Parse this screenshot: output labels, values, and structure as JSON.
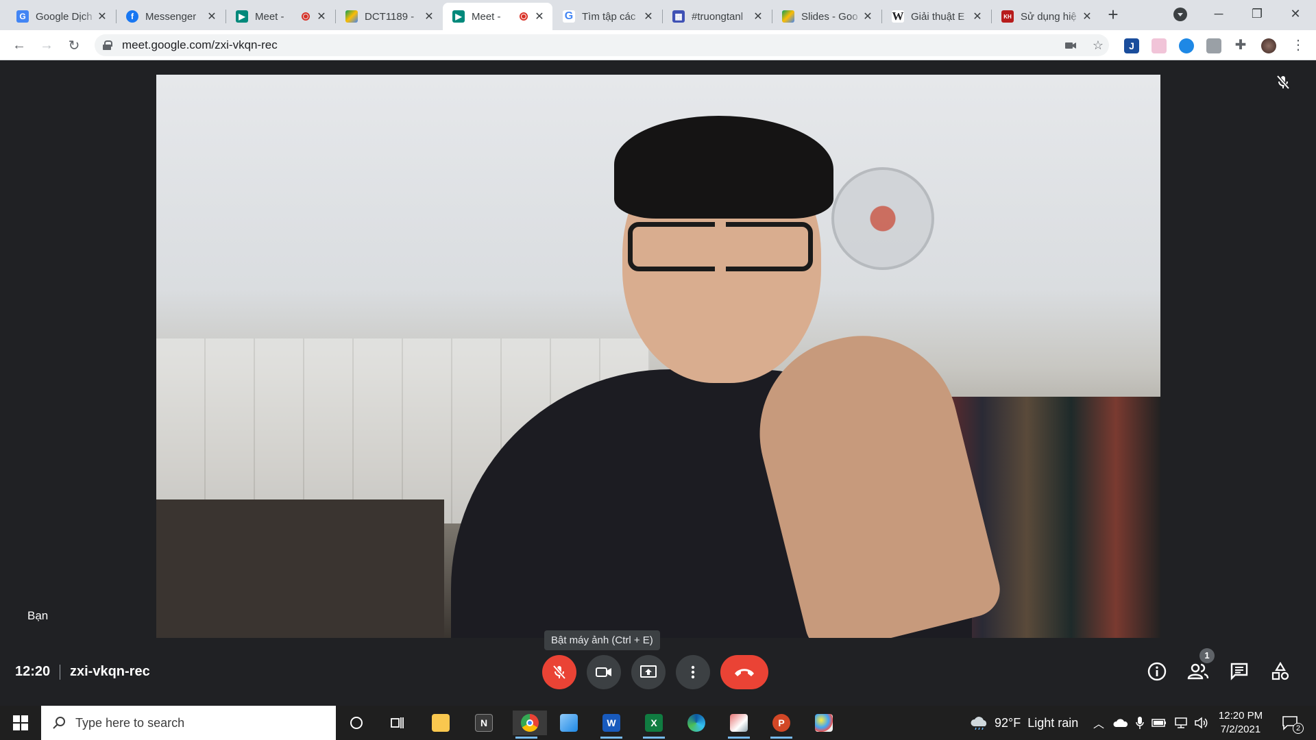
{
  "browser": {
    "tabs": [
      {
        "title": "Google Dịch",
        "favicon": "google-translate-icon",
        "color": "#4285f4"
      },
      {
        "title": "Messenger",
        "favicon": "facebook-icon",
        "color": "#1877f2"
      },
      {
        "title": "Meet -",
        "favicon": "google-meet-icon",
        "color": "#00897b",
        "recording": true
      },
      {
        "title": "DCT1189 -",
        "favicon": "google-drive-icon",
        "color": "#fbbc04"
      },
      {
        "title": "Meet -",
        "favicon": "google-meet-icon",
        "color": "#00897b",
        "recording": true,
        "active": true
      },
      {
        "title": "Tìm tập các",
        "favicon": "google-icon",
        "color": "#ea4335"
      },
      {
        "title": "#truongtanl",
        "favicon": "calendar-table-icon",
        "color": "#3f51b5"
      },
      {
        "title": "Slides - Goo",
        "favicon": "google-drive-icon",
        "color": "#fbbc04"
      },
      {
        "title": "Giải thuật E",
        "favicon": "wikipedia-icon",
        "color": "#ffffff"
      },
      {
        "title": "Sử dụng hiệ",
        "favicon": "khpt-icon",
        "color": "#b71c1c"
      }
    ],
    "url": "meet.google.com/zxi-vkqn-rec"
  },
  "meet": {
    "participant_name": "Bạn",
    "tooltip": "Bật máy ảnh (Ctrl + E)",
    "time": "12:20",
    "meeting_code": "zxi-vkqn-rec",
    "people_count": "1",
    "controls": {
      "mic": "mic-off-icon",
      "camera": "camera-icon",
      "present": "present-screen-icon",
      "more": "more-options-icon",
      "hangup": "end-call-icon"
    },
    "right_controls": [
      "info-icon",
      "people-icon",
      "chat-icon",
      "activities-icon"
    ],
    "colors": {
      "red": "#ea4335",
      "control_bg": "#3c4043",
      "background": "#202124"
    }
  },
  "taskbar": {
    "search_placeholder": "Type here to search",
    "weather": "92°F  Light rain",
    "time": "12:20 PM",
    "date": "7/2/2021",
    "notification_count": "2"
  }
}
